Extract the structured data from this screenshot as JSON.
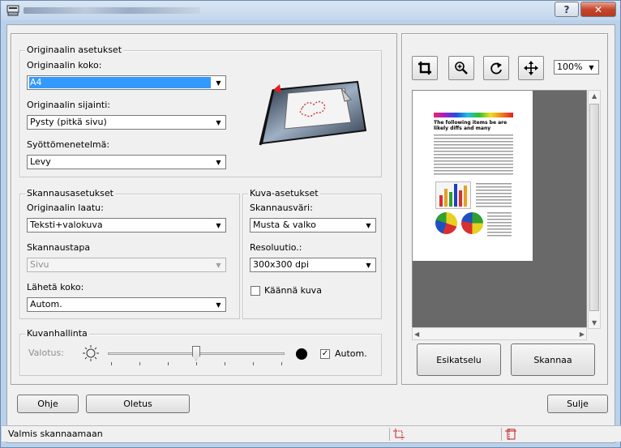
{
  "window": {
    "help_label": "?",
    "close_label": "✕"
  },
  "original": {
    "legend": "Originaalin asetukset",
    "size_label": "Originaalin koko:",
    "size_value": "A4",
    "placement_label": "Originaalin sijainti:",
    "placement_value": "Pysty (pitkä sivu)",
    "feed_label": "Syöttömenetelmä:",
    "feed_value": "Levy"
  },
  "scan": {
    "legend": "Skannausasetukset",
    "quality_label": "Originaalin laatu:",
    "quality_value": "Teksti+valokuva",
    "method_label": "Skannaustapa",
    "method_value": "Sivu",
    "send_size_label": "Lähetä koko:",
    "send_size_value": "Autom."
  },
  "image": {
    "legend": "Kuva-asetukset",
    "color_label": "Skannausväri:",
    "color_value": "Musta & valko",
    "resolution_label": "Resoluutio.:",
    "resolution_value": "300x300 dpi",
    "rotate_label": "Käännä kuva",
    "rotate_checked": false
  },
  "image_control": {
    "legend": "Kuvanhallinta",
    "exposure_label": "Valotus:",
    "auto_label": "Autom.",
    "auto_checked": true,
    "exposure_level": 0.5
  },
  "preview": {
    "zoom_value": "100%",
    "tools": [
      "crop-icon",
      "zoom-in-icon",
      "rotate-icon",
      "move-icon"
    ],
    "preview_button": "Esikatselu",
    "scan_button": "Skannaa",
    "doc_heading": "The following items be are likely diffs and many"
  },
  "bottom": {
    "help_button": "Ohje",
    "defaults_button": "Oletus",
    "close_button": "Sulje"
  },
  "status": {
    "text": "Valmis skannaamaan"
  }
}
